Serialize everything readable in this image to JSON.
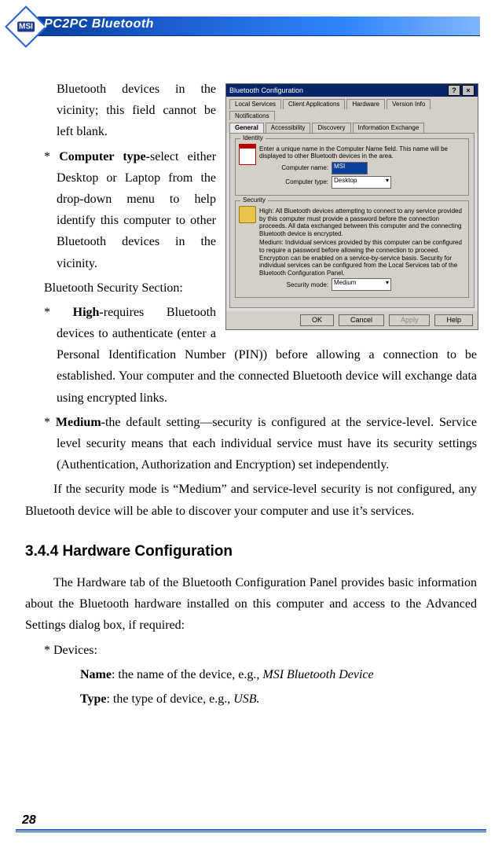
{
  "header": {
    "badge": "MSI",
    "title": "PC2PC Bluetooth"
  },
  "page_number": "28",
  "text": {
    "p1": "Bluetooth devices in the vicinity; this field cannot be left blank.",
    "p2a": "* ",
    "p2b": "Computer type-",
    "p2c": "select either Desktop or Laptop from the drop-down menu to help identify this computer to other Bluetooth devices in the vicinity.",
    "p3": "Bluetooth Security Section:",
    "p4a": "* ",
    "p4b": "High-",
    "p4c": "requires Bluetooth devices to authenticate (enter a Personal Identification Number (PIN)) before allowing a connection to be established. Your computer and the connected Bluetooth device will exchange data using encrypted links.",
    "p5a": "* ",
    "p5b": "Medium-",
    "p5c": "the default setting—security is configured at the service-level. Service level security means that each individual service must have its security settings (Authentication, Authorization and Encryption) set independently.",
    "p6": "If the security mode is “Medium” and service-level security is not configured, any Bluetooth device will be able to discover your computer and use it’s services.",
    "h1": "3.4.4  Hardware Configuration",
    "p7": "The Hardware tab of the Bluetooth Configuration Panel provides basic information about the Bluetooth hardware installed on this computer and access to the Advanced Settings dialog box, if required:",
    "p8": "* Devices:",
    "p9a": "Name",
    "p9b": ": the name of the device, e.g., ",
    "p9c": "MSI Bluetooth Device",
    "p10a": "Type",
    "p10b": ": the type of device, e.g., ",
    "p10c": "USB."
  },
  "screenshot": {
    "title": "Bluetooth Configuration",
    "help_btn": "?",
    "close_btn": "×",
    "tabs_row1": [
      "Local Services",
      "Client Applications",
      "Hardware",
      "Version Info",
      "Notifications"
    ],
    "tabs_row2": [
      "General",
      "Accessibility",
      "Discovery",
      "Information Exchange"
    ],
    "identity": {
      "legend": "Identity",
      "desc": "Enter a unique name in the Computer Name field. This name will be displayed to other Bluetooth devices in the area.",
      "name_label": "Computer name:",
      "name_value": "MSI",
      "type_label": "Computer type:",
      "type_value": "Desktop"
    },
    "security": {
      "legend": "Security",
      "high": "High: All Bluetooth devices attempting to connect to any service provided by this computer must provide a password before the connection proceeds. All data exchanged between this computer and the connecting Bluetooth device is encrypted.",
      "medium": "Medium: Individual services provided by this computer can be configured to require a password before allowing the connection to proceed. Encryption can be enabled on a service-by-service basis. Security for individual services can be configured from the Local Services tab of the Bluetooth Configuration Panel.",
      "mode_label": "Security mode:",
      "mode_value": "Medium"
    },
    "buttons": {
      "ok": "OK",
      "cancel": "Cancel",
      "apply": "Apply",
      "help": "Help"
    }
  }
}
